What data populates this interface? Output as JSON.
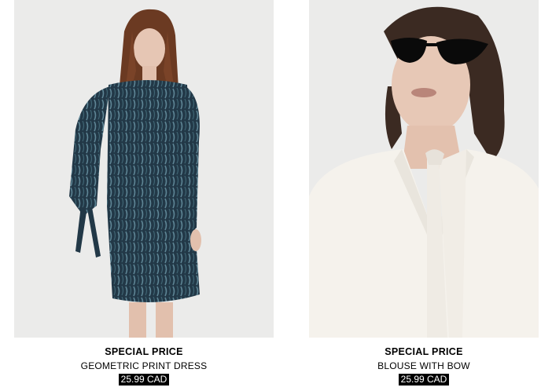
{
  "products": [
    {
      "label": "SPECIAL PRICE",
      "name": "GEOMETRIC PRINT DRESS",
      "price": "25.99 CAD",
      "image_subject": "model in navy geometric print long-sleeve mini dress"
    },
    {
      "label": "SPECIAL PRICE",
      "name": "BLOUSE WITH BOW",
      "price": "25.99 CAD",
      "image_subject": "model in white blouse with neck bow and black cat-eye sunglasses"
    }
  ],
  "colors": {
    "background": "#ffffff",
    "photo_backdrop": "#ebebea",
    "price_badge": "#000000",
    "price_text": "#ffffff"
  }
}
